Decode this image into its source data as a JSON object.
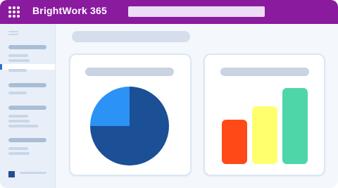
{
  "app": {
    "name": "BrightWork 365"
  },
  "colors": {
    "header": "#8a1a9e",
    "pie_dark": "#1b4f96",
    "pie_light": "#2b93f5",
    "bar_red": "#ff4a17",
    "bar_yellow": "#ffff6e",
    "bar_green": "#4fd6a8"
  },
  "icons": {
    "menu": "apps-grid-icon"
  },
  "chart_data": [
    {
      "type": "pie",
      "values": [
        75,
        25
      ]
    },
    {
      "type": "bar",
      "values": [
        0.58,
        0.76,
        1.0
      ]
    }
  ]
}
